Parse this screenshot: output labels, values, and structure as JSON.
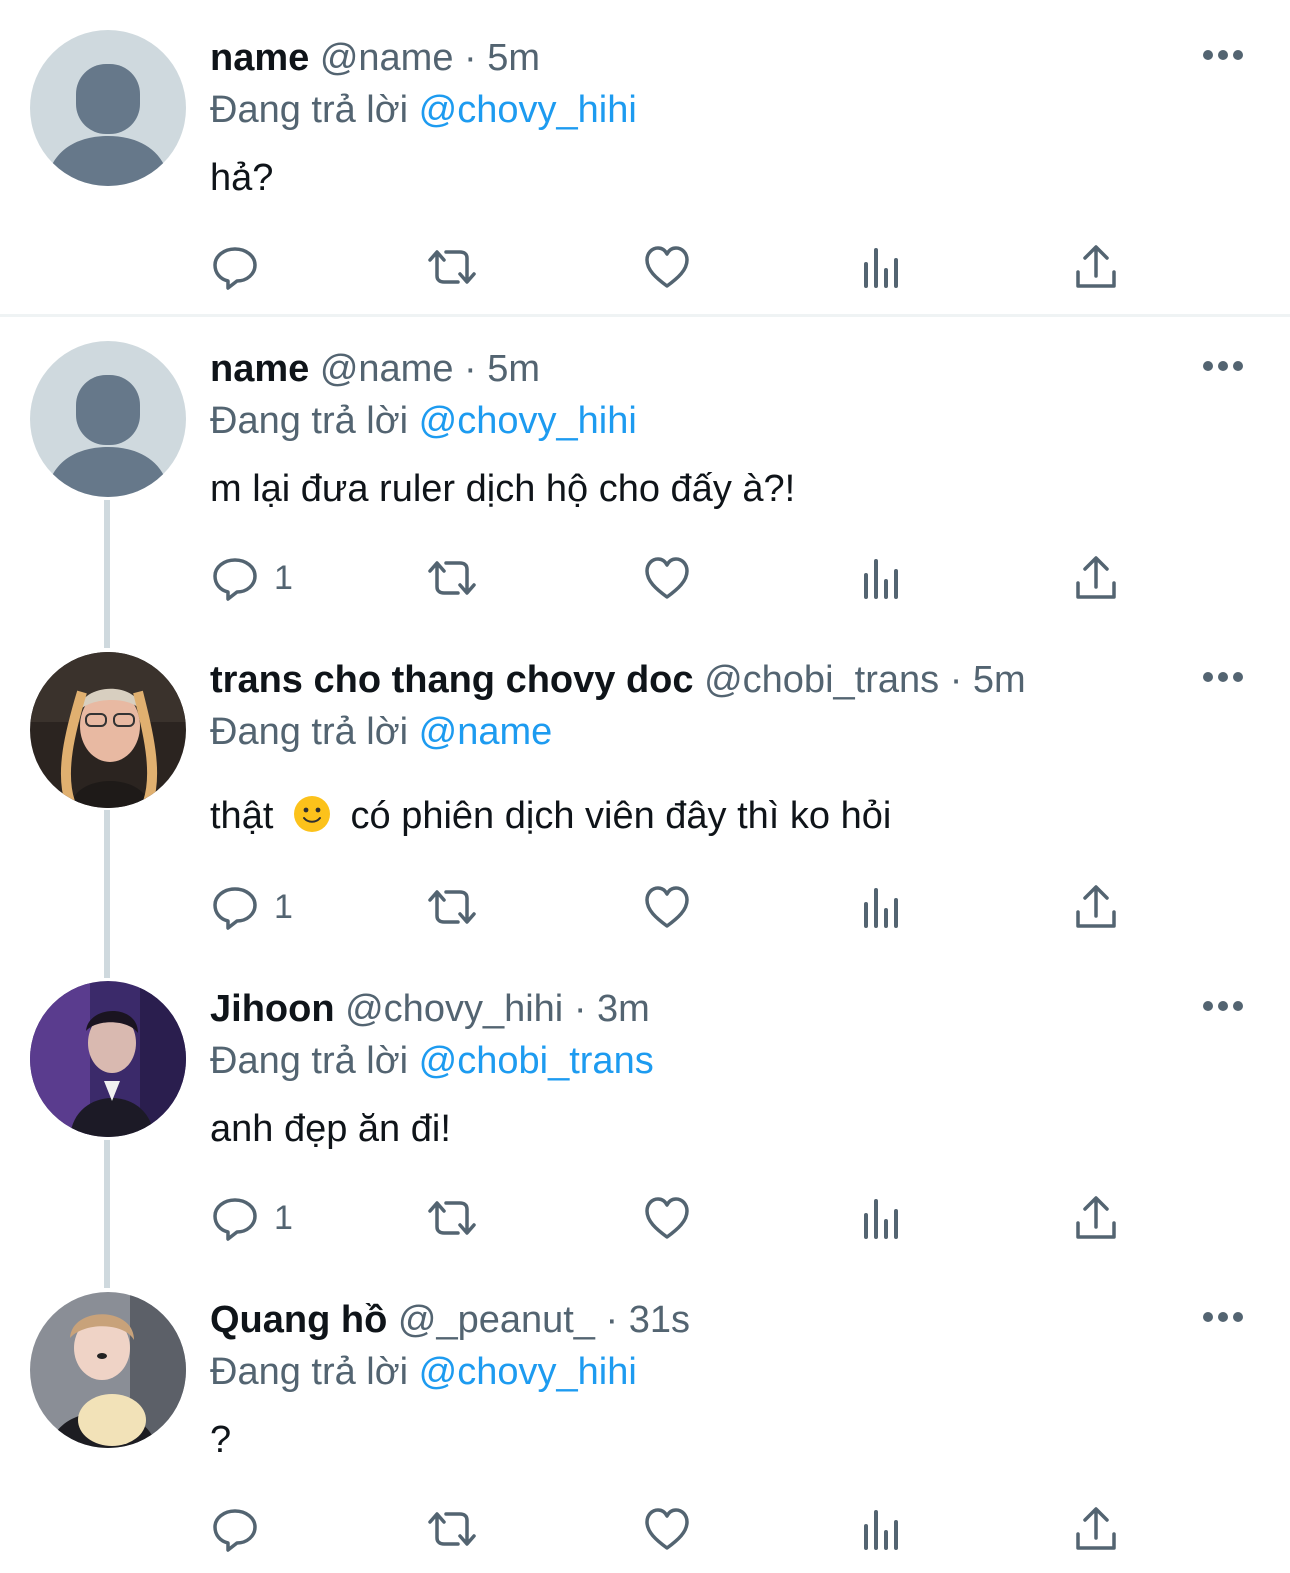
{
  "reply_prefix": "Đang trả lời",
  "tweets": [
    {
      "name": "name",
      "handle": "@name",
      "sep": "·",
      "time": "5m",
      "reply_to": "@chovy_hihi",
      "text": "hả?",
      "reply_count": "",
      "avatar": "default-avatar"
    },
    {
      "name": "name",
      "handle": "@name",
      "sep": "·",
      "time": "5m",
      "reply_to": "@chovy_hihi",
      "text": "m lại đưa ruler dịch hộ cho đấy à?!",
      "reply_count": "1",
      "avatar": "default-avatar"
    },
    {
      "name": "trans cho thang chovy doc",
      "handle": "@chobi_trans",
      "sep": "·",
      "time": "5m",
      "reply_to": "@name",
      "text_before_emoji": "thật",
      "emoji": "slightly-smiling-face",
      "text_after_emoji": "có phiên dịch viên đây thì ko hỏi",
      "reply_count": "1",
      "avatar": "photo-avatar"
    },
    {
      "name": "Jihoon",
      "handle": "@chovy_hihi",
      "sep": "·",
      "time": "3m",
      "reply_to": "@chobi_trans",
      "text": "anh đẹp ăn đi!",
      "reply_count": "1",
      "avatar": "photo-avatar"
    },
    {
      "name": "Quang hồ",
      "handle": "@_peanut_",
      "sep": "·",
      "time": "31s",
      "reply_to": "@chovy_hihi",
      "text": "?",
      "reply_count": "",
      "avatar": "photo-avatar"
    }
  ],
  "colors": {
    "link": "#1d9bf0",
    "secondary_text": "#536471",
    "primary_text": "#0f1419",
    "thread_line": "#cfd9de"
  },
  "action_icons": [
    "reply-icon",
    "retweet-icon",
    "like-icon",
    "views-icon",
    "share-icon"
  ]
}
